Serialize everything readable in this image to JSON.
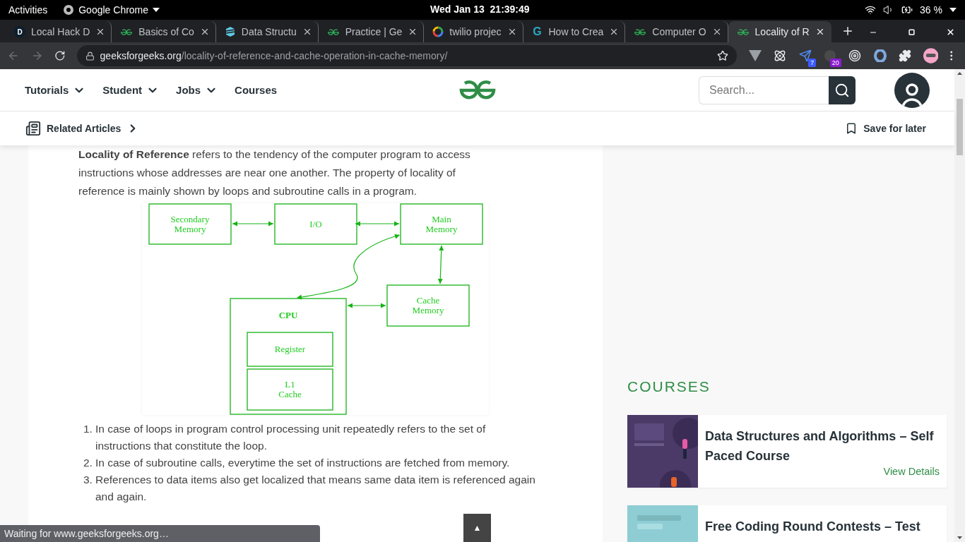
{
  "top_bar": {
    "activities": "Activities",
    "app": "Google Chrome",
    "clock": "Wed Jan 13  21:39:49",
    "battery": "36 %"
  },
  "tabs": [
    {
      "title": "Local Hack D",
      "kind": "letter",
      "letter": "D",
      "selected": false
    },
    {
      "title": "Basics of Co",
      "kind": "gfg",
      "selected": false
    },
    {
      "title": "Data Structu",
      "kind": "layers",
      "selected": false
    },
    {
      "title": "Practice | Ge",
      "kind": "gfg",
      "selected": false
    },
    {
      "title": "twilio projec",
      "kind": "google",
      "selected": false
    },
    {
      "title": "How to Crea",
      "kind": "glyph",
      "letter": "G",
      "selected": false
    },
    {
      "title": "Computer O",
      "kind": "gfg",
      "selected": false
    },
    {
      "title": "Locality of R",
      "kind": "gfg",
      "selected": true
    }
  ],
  "address": {
    "host": "geeksforgeeks.org",
    "path": "/locality-of-reference-and-cache-operation-in-cache-memory/"
  },
  "extensions": [
    {
      "kind": "vee"
    },
    {
      "kind": "atom"
    },
    {
      "kind": "plane",
      "badge": "7",
      "color": "#3d5afe"
    },
    {
      "kind": "dark",
      "badge": "20",
      "color": "#8a1ccf"
    },
    {
      "kind": "target"
    },
    {
      "kind": "ring"
    },
    {
      "kind": "puzzle"
    }
  ],
  "site_nav": [
    {
      "label": "Tutorials",
      "dropdown": true
    },
    {
      "label": "Student",
      "dropdown": true
    },
    {
      "label": "Jobs",
      "dropdown": true
    },
    {
      "label": "Courses",
      "dropdown": false
    }
  ],
  "search": {
    "placeholder": "Search..."
  },
  "sub_bar": {
    "related": "Related Articles",
    "save": "Save for later"
  },
  "article": {
    "intro": "**Locality of Reference** refers to the tendency of the computer program to access instructions whose addresses are near one another. The property of locality of reference is mainly shown by loops and subroutine calls in a program.",
    "diagram": {
      "boxes": [
        {
          "lines": [
            "Secondary",
            "Memory"
          ]
        },
        {
          "lines": [
            "I/O"
          ]
        },
        {
          "lines": [
            "Main",
            "Memory"
          ]
        },
        {
          "lines": [
            "Cache",
            "Memory"
          ]
        },
        {
          "lines": [
            "CPU"
          ],
          "children": [
            {
              "lines": [
                "Register"
              ]
            },
            {
              "lines": [
                "L1",
                "Cache"
              ]
            }
          ]
        }
      ]
    },
    "list": [
      {
        "number": "1.",
        "text": "In case of loops in program control processing unit repeatedly refers to the set of instructions that constitute the loop."
      },
      {
        "number": "2.",
        "text": "In case of subroutine calls, everytime the set of instructions are fetched from memory."
      },
      {
        "number": "3.",
        "text": "References to data items also get localized that means same data item is referenced again and again."
      }
    ]
  },
  "sidebar": {
    "heading": "COURSES",
    "courses": [
      {
        "kind": "picture",
        "title": "Data Structures and Algorithms – Self Paced Course",
        "link": "View Details"
      },
      {
        "kind": "picture",
        "title": "Free Coding Round Contests – Test"
      }
    ]
  },
  "status": "Waiting for www.geeksforgeeks.org…",
  "scroll_top": "▲"
}
